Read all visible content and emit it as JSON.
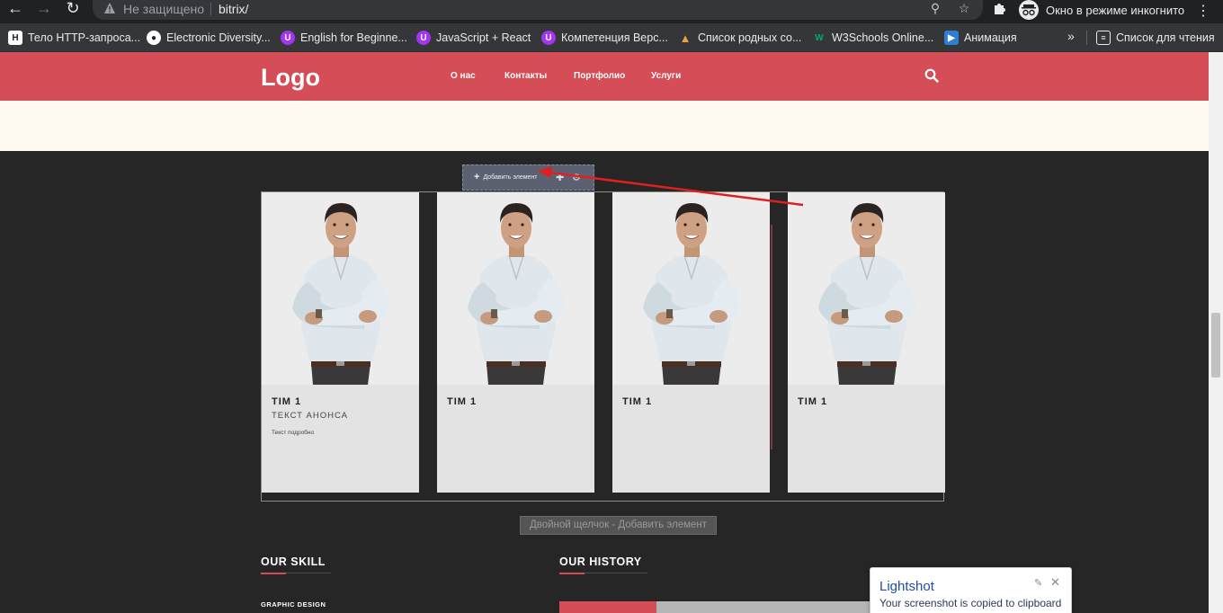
{
  "browser": {
    "security_label": "Не защищено",
    "url": "bitrix/",
    "incognito_label": "Окно в режиме инкогнито",
    "bookmarks": [
      {
        "label": "Тело HTTP-запроса...",
        "icon": "document-icon",
        "color": "#ffffff"
      },
      {
        "label": "Electronic Diversity...",
        "icon": "globe-icon",
        "color": "#ffffff"
      },
      {
        "label": "English for Beginne...",
        "icon": "udemy-icon",
        "color": "#a435f0"
      },
      {
        "label": "JavaScript + React",
        "icon": "udemy-icon",
        "color": "#a435f0"
      },
      {
        "label": "Компетенция Верс...",
        "icon": "udemy-icon",
        "color": "#a435f0"
      },
      {
        "label": "Список родных со...",
        "icon": "flame-icon",
        "color": "#e8a43b"
      },
      {
        "label": "W3Schools Online...",
        "icon": "w3schools-icon",
        "color": "#04aa6d"
      },
      {
        "label": "Анимация",
        "icon": "play-icon",
        "color": "#2d7fd1"
      }
    ],
    "more_label": "»",
    "reading_list_label": "Список для чтения"
  },
  "site": {
    "logo": "Logo",
    "menu": [
      "О нас",
      "Контакты",
      "Портфолио",
      "Услуги"
    ],
    "accent_color": "#d44d57"
  },
  "editor": {
    "add_element_label": "Добавить элемент",
    "double_click_hint": "Двойной щелчок - Добавить элемент"
  },
  "cards": [
    {
      "title": "TIM 1",
      "subtitle": "ТЕКСТ АНОНСА",
      "text": "Текст подробно"
    },
    {
      "title": "TIM 1",
      "subtitle": "",
      "text": ""
    },
    {
      "title": "TIM 1",
      "subtitle": "",
      "text": ""
    },
    {
      "title": "TIM 1",
      "subtitle": "",
      "text": ""
    }
  ],
  "sections": {
    "skill_title": "OUR SKILL",
    "history_title": "OUR HISTORY",
    "skill_item": "GRAPHIC DESIGN",
    "history_progress": 0.3
  },
  "lightshot": {
    "title": "Lightshot",
    "message": "Your screenshot is copied to clipboard"
  }
}
